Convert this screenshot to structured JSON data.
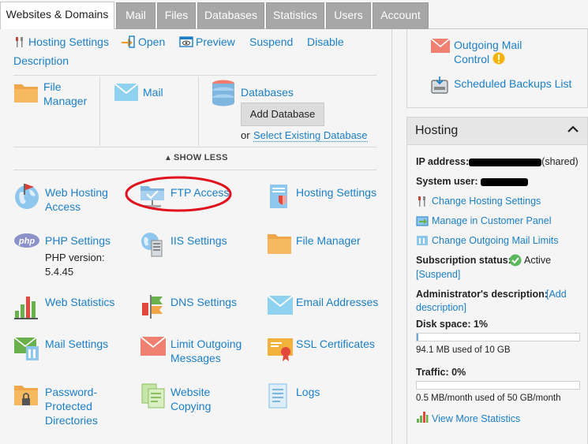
{
  "tabs": [
    "Websites & Domains",
    "Mail",
    "Files",
    "Databases",
    "Statistics",
    "Users",
    "Account"
  ],
  "toolbar": {
    "hosting_settings": "Hosting Settings",
    "open": "Open",
    "preview": "Preview",
    "suspend": "Suspend",
    "disable": "Disable",
    "description": "Description"
  },
  "quick": {
    "file_manager": "File Manager",
    "mail": "Mail",
    "databases": "Databases",
    "add_database": "Add Database",
    "or": "or",
    "select_existing": "Select Existing Database"
  },
  "show_less": "SHOW LESS",
  "features": [
    {
      "label": "Web Hosting Access"
    },
    {
      "label": "FTP Access"
    },
    {
      "label": "Hosting Settings"
    },
    {
      "label": "PHP Settings",
      "sub1": "PHP version:",
      "sub2": "5.4.45"
    },
    {
      "label": "IIS Settings"
    },
    {
      "label": "File Manager"
    },
    {
      "label": "Web Statistics"
    },
    {
      "label": "DNS Settings"
    },
    {
      "label": "Email Addresses"
    },
    {
      "label": "Mail Settings"
    },
    {
      "label": "Limit Outgoing Messages"
    },
    {
      "label": "SSL Certificates"
    },
    {
      "label": "Password-Protected Directories"
    },
    {
      "label": "Website Copying"
    },
    {
      "label": "Logs"
    }
  ],
  "sidebar": {
    "outgoing_mail_control": "Outgoing Mail Control",
    "scheduled_backups": "Scheduled Backups List",
    "hosting_title": "Hosting",
    "ip_label": "IP address:",
    "ip_suffix": "(shared)",
    "system_user_label": "System user:",
    "change_hosting": "Change Hosting Settings",
    "manage_customer": "Manage in Customer Panel",
    "change_mail_limits": "Change Outgoing Mail Limits",
    "subscription_status_label": "Subscription status:",
    "status_active": "Active",
    "suspend_link": "[Suspend]",
    "admin_desc_label": "Administrator's description:",
    "add_link_1": "[Add",
    "add_link_2": "description]",
    "disk_space_label": "Disk space: 1%",
    "disk_usage": "94.1 MB used of 10 GB",
    "disk_percent": 1,
    "traffic_label": "Traffic: 0%",
    "traffic_usage": "0.5 MB/month used of 50 GB/month",
    "traffic_percent": 0,
    "view_more_stats": "View More Statistics"
  },
  "colors": {
    "link": "#1b7fc6",
    "active_green": "#5cb85c",
    "annotation_red": "#e0121f"
  }
}
